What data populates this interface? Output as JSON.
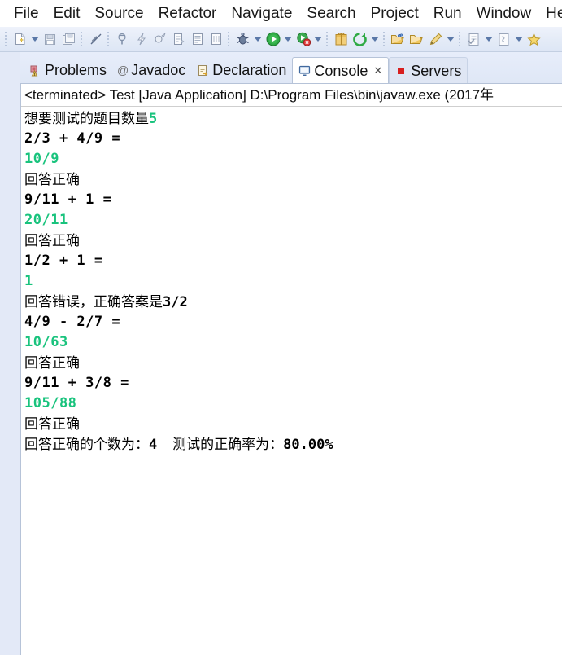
{
  "menubar": {
    "items": [
      {
        "label": "File"
      },
      {
        "label": "Edit"
      },
      {
        "label": "Source"
      },
      {
        "label": "Refactor"
      },
      {
        "label": "Navigate"
      },
      {
        "label": "Search"
      },
      {
        "label": "Project"
      },
      {
        "label": "Run"
      },
      {
        "label": "Window"
      },
      {
        "label": "Help"
      }
    ]
  },
  "toolbar": {
    "buttons": [
      {
        "icon": "new-file-icon",
        "enabled": false,
        "dropdown": true
      },
      {
        "icon": "save-icon",
        "enabled": false,
        "dropdown": false
      },
      {
        "icon": "save-all-icon",
        "enabled": false,
        "dropdown": false
      },
      {
        "icon": "no-link-icon",
        "enabled": false,
        "dropdown": false
      },
      {
        "icon": "print-icon",
        "enabled": false,
        "dropdown": false
      },
      {
        "icon": "quick-fix-icon",
        "enabled": false,
        "dropdown": false
      },
      {
        "icon": "build-icon",
        "enabled": false,
        "dropdown": false
      },
      {
        "icon": "open-task-icon",
        "enabled": false,
        "dropdown": false
      },
      {
        "icon": "open-editor-icon",
        "enabled": false,
        "dropdown": false
      },
      {
        "icon": "measure-icon",
        "enabled": false,
        "dropdown": false
      },
      {
        "icon": "debug-icon",
        "enabled": true,
        "dropdown": true
      },
      {
        "icon": "run-icon",
        "enabled": true,
        "dropdown": true
      },
      {
        "icon": "run-external-icon",
        "enabled": true,
        "dropdown": true
      },
      {
        "icon": "new-package-icon",
        "enabled": true,
        "dropdown": false
      },
      {
        "icon": "refresh-icon",
        "enabled": true,
        "dropdown": true
      },
      {
        "icon": "open-type-icon",
        "enabled": true,
        "dropdown": false
      },
      {
        "icon": "open-folder-icon",
        "enabled": true,
        "dropdown": false
      },
      {
        "icon": "search-pencil-icon",
        "enabled": true,
        "dropdown": true
      },
      {
        "icon": "next-annotation-icon",
        "enabled": false,
        "dropdown": true
      },
      {
        "icon": "previous-edit-icon",
        "enabled": false,
        "dropdown": true
      },
      {
        "icon": "star-icon",
        "enabled": true,
        "dropdown": false
      }
    ]
  },
  "tabs": [
    {
      "label": "Problems",
      "icon": "problems-icon",
      "active": false,
      "closable": false
    },
    {
      "label": "Javadoc",
      "icon": "javadoc-at-icon",
      "active": false,
      "closable": false
    },
    {
      "label": "Declaration",
      "icon": "declaration-icon",
      "active": false,
      "closable": false
    },
    {
      "label": "Console",
      "icon": "console-icon",
      "active": true,
      "closable": true,
      "close_glyph": "✕"
    },
    {
      "label": "Servers",
      "icon": "servers-icon",
      "active": false,
      "closable": false
    }
  ],
  "console": {
    "header": "<terminated> Test [Java Application] D:\\Program Files\\bin\\javaw.exe (2017年",
    "lines": [
      {
        "type": "prompt",
        "text": "想要测试的题目数量",
        "value": "5"
      },
      {
        "type": "question",
        "text": "2/3 + 4/9 ="
      },
      {
        "type": "answer",
        "text": "10/9"
      },
      {
        "type": "result",
        "text": "回答正确"
      },
      {
        "type": "question",
        "text": "9/11 + 1 ="
      },
      {
        "type": "answer",
        "text": "20/11"
      },
      {
        "type": "result",
        "text": "回答正确"
      },
      {
        "type": "question",
        "text": "1/2 + 1 ="
      },
      {
        "type": "answer",
        "text": "1"
      },
      {
        "type": "result-wrong",
        "text": "回答错误，正确答案是",
        "value": "3/2"
      },
      {
        "type": "question",
        "text": "4/9 - 2/7 ="
      },
      {
        "type": "answer",
        "text": "10/63"
      },
      {
        "type": "result",
        "text": "回答正确"
      },
      {
        "type": "question",
        "text": "9/11 + 3/8 ="
      },
      {
        "type": "answer",
        "text": "105/88"
      },
      {
        "type": "result",
        "text": "回答正确"
      }
    ],
    "summary": {
      "correct_label": "回答正确的个数为：",
      "correct_count": "4",
      "gap": "    ",
      "rate_label": "测试的正确率为：",
      "rate_value": "80.00%"
    }
  },
  "colors": {
    "answer_green": "#19c37d",
    "console_bg": "#ffffff",
    "chrome_blue": "#e3e9f7"
  }
}
